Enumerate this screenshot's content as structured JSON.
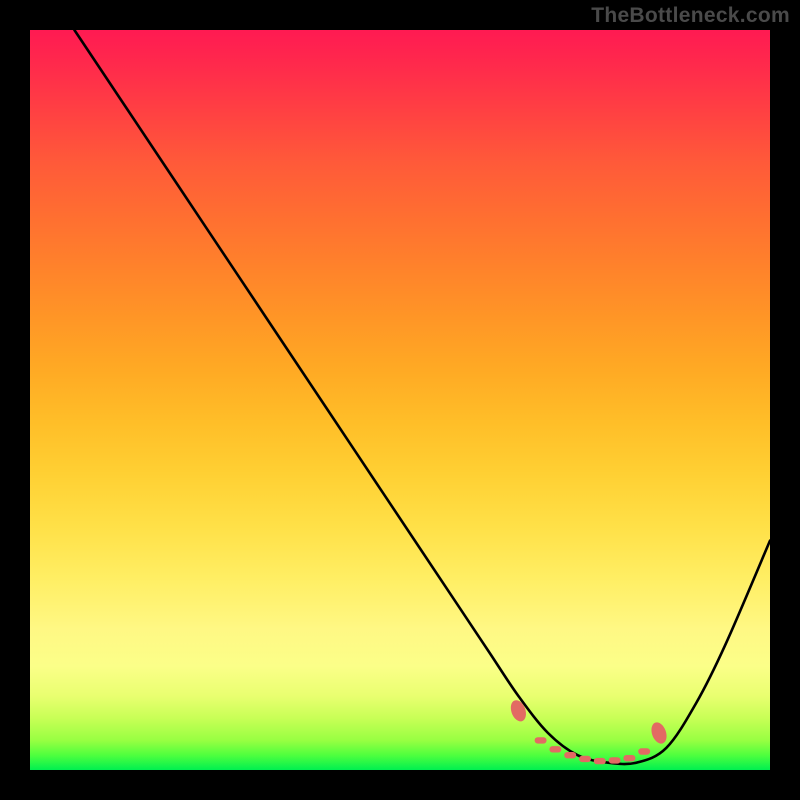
{
  "watermark": "TheBottleneck.com",
  "chart_data": {
    "type": "line",
    "title": "",
    "xlabel": "",
    "ylabel": "",
    "xlim": [
      0,
      100
    ],
    "ylim": [
      0,
      100
    ],
    "series": [
      {
        "name": "bottleneck-curve",
        "x": [
          6,
          12,
          20,
          28,
          36,
          44,
          52,
          58,
          62,
          66,
          70,
          74,
          78,
          82,
          86,
          90,
          94,
          100
        ],
        "values": [
          100,
          91,
          79,
          67,
          55,
          43,
          31,
          22,
          16,
          10,
          5,
          2,
          1,
          1,
          3,
          9,
          17,
          31
        ]
      }
    ],
    "highlight_points": {
      "name": "optimal-range-markers",
      "color": "#e26a63",
      "x": [
        66,
        69,
        71,
        73,
        75,
        77,
        79,
        81,
        83,
        85
      ],
      "values": [
        8,
        4,
        2.8,
        2,
        1.5,
        1.2,
        1.3,
        1.6,
        2.5,
        5
      ]
    },
    "gradient_stops": [
      {
        "pos": 0,
        "color": "#ff1a52"
      },
      {
        "pos": 25,
        "color": "#ff6e31"
      },
      {
        "pos": 50,
        "color": "#ffb825"
      },
      {
        "pos": 75,
        "color": "#fff068"
      },
      {
        "pos": 92,
        "color": "#d8ff5a"
      },
      {
        "pos": 100,
        "color": "#00f050"
      }
    ]
  }
}
